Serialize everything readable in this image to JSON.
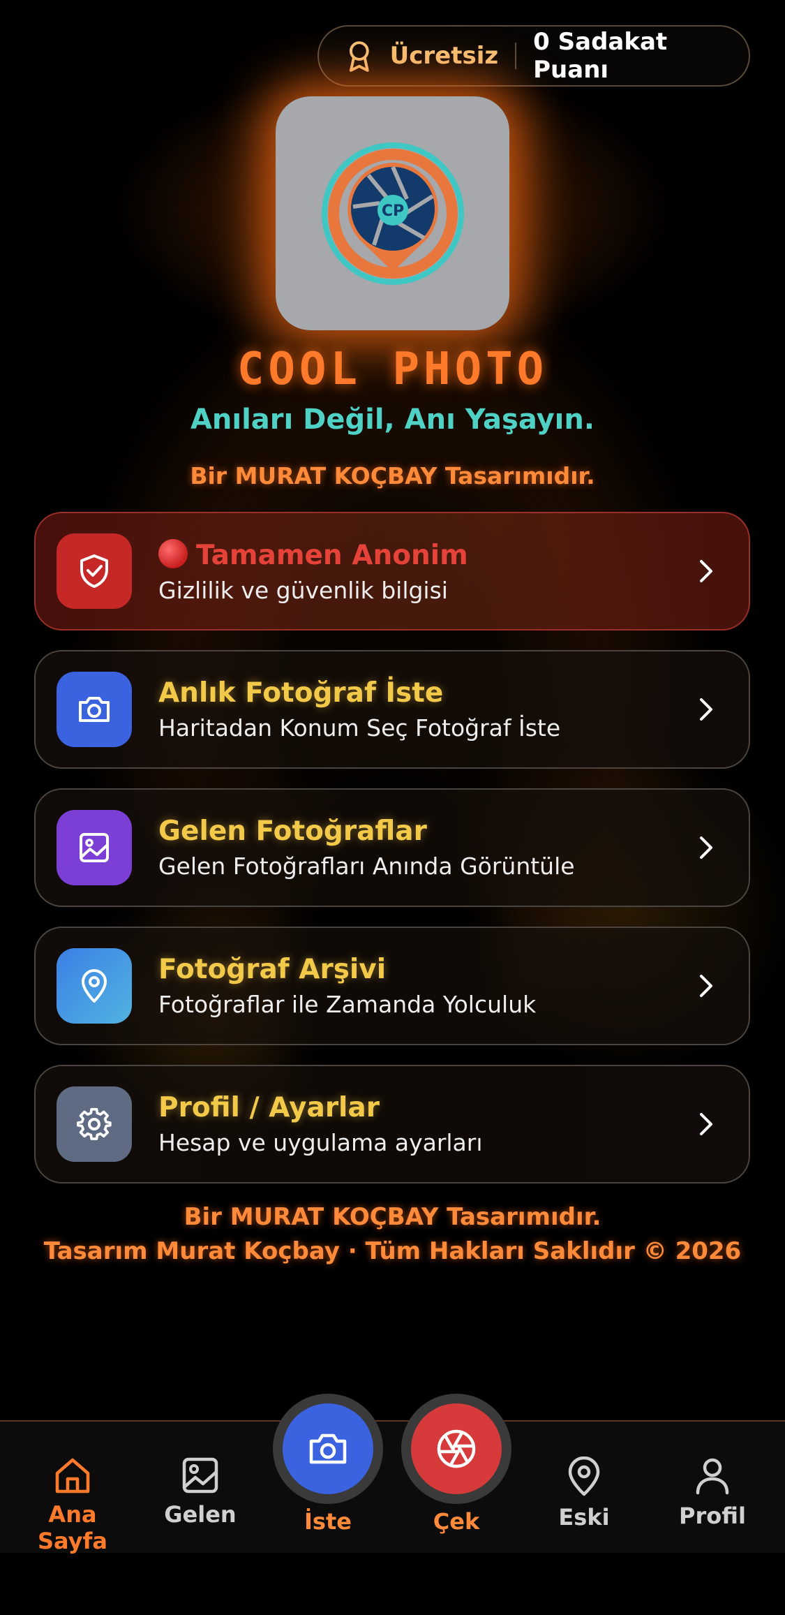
{
  "badge": {
    "plan": "Ücretsiz",
    "points": "0 Sadakat Puanı"
  },
  "header": {
    "app_name": "COOL PHOTO",
    "tagline": "Anıları Değil, Anı Yaşayın.",
    "designer": "Bir MURAT KOÇBAY Tasarımıdır."
  },
  "cards": [
    {
      "title": "Tamamen Anonim",
      "subtitle": "Gizlilik ve güvenlik bilgisi",
      "icon": "shield-check-icon",
      "color": "#c62828"
    },
    {
      "title": "Anlık Fotoğraf İste",
      "subtitle": "Haritadan Konum Seç Fotoğraf İste",
      "icon": "camera-icon",
      "color": "#3b63e0"
    },
    {
      "title": "Gelen Fotoğraflar",
      "subtitle": "Gelen Fotoğrafları Anında Görüntüle",
      "icon": "image-icon",
      "color": "#7b3fd6"
    },
    {
      "title": "Fotoğraf Arşivi",
      "subtitle": "Fotoğraflar ile Zamanda Yolculuk",
      "icon": "map-pin-icon",
      "color": "#4aa0e6"
    },
    {
      "title": "Profil / Ayarlar",
      "subtitle": "Hesap ve uygulama ayarları",
      "icon": "gear-icon",
      "color": "#5f6b82"
    }
  ],
  "footer": {
    "line1": "Bir MURAT KOÇBAY Tasarımıdır.",
    "line2": "Tasarım Murat Koçbay · Tüm Hakları Saklıdır © 2026"
  },
  "nav": {
    "home": "Ana Sayfa",
    "incoming": "Gelen",
    "request": "İste",
    "capture": "Çek",
    "archive": "Eski",
    "profile": "Profil"
  },
  "colors": {
    "accent": "#ff7a2a",
    "teal": "#4fd1c5",
    "gold": "#f3c94a"
  }
}
